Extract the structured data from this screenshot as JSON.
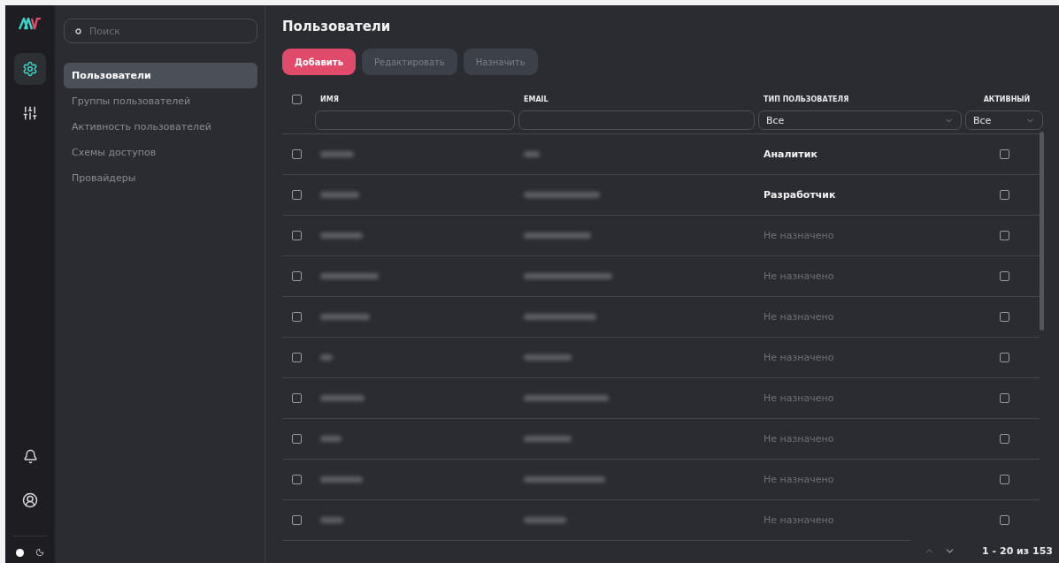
{
  "sidebar": {
    "search": {
      "placeholder": "Поиск"
    },
    "items": [
      {
        "label": "Пользователи",
        "selected": true
      },
      {
        "label": "Группы пользователей",
        "selected": false
      },
      {
        "label": "Активность пользователей",
        "selected": false
      },
      {
        "label": "Схемы доступов",
        "selected": false
      },
      {
        "label": "Провайдеры",
        "selected": false
      }
    ]
  },
  "rail": {
    "items": [
      {
        "kind": "settings",
        "selected": true
      },
      {
        "kind": "sliders",
        "selected": false
      }
    ],
    "theme_dark": true
  },
  "page": {
    "title": "Пользователи"
  },
  "buttons": [
    {
      "label": "Добавить",
      "disabled": false
    },
    {
      "label": "Редактировать",
      "disabled": true
    },
    {
      "label": "Назначить",
      "disabled": true
    }
  ],
  "table": {
    "select_all_checked": false,
    "columns": [
      {
        "label": "ИМЯ",
        "filter": {
          "kind": "text"
        }
      },
      {
        "label": "EMAIL",
        "filter": {
          "kind": "text"
        }
      },
      {
        "label": "ТИП ПОЛЬЗОВАТЕЛЯ",
        "filter": {
          "kind": "select",
          "value": "Все"
        }
      },
      {
        "label": "АКТИВНЫЙ",
        "filter": {
          "kind": "select",
          "value": "Все"
        }
      }
    ],
    "rows": [
      {
        "checked": false,
        "type": "Аналитик",
        "assigned": true,
        "active": false
      },
      {
        "checked": false,
        "type": "Разработчик",
        "assigned": true,
        "active": false
      },
      {
        "checked": false,
        "type": "Не назначено",
        "assigned": false,
        "active": false
      },
      {
        "checked": false,
        "type": "Не назначено",
        "assigned": false,
        "active": false
      },
      {
        "checked": false,
        "type": "Не назначено",
        "assigned": false,
        "active": false
      },
      {
        "checked": false,
        "type": "Не назначено",
        "assigned": false,
        "active": false
      },
      {
        "checked": false,
        "type": "Не назначено",
        "assigned": false,
        "active": false
      },
      {
        "checked": false,
        "type": "Не назначено",
        "assigned": false,
        "active": false
      },
      {
        "checked": false,
        "type": "Не назначено",
        "assigned": false,
        "active": false
      },
      {
        "checked": false,
        "type": "Не назначено",
        "assigned": false,
        "active": false
      }
    ]
  },
  "pagination": {
    "range": "1 - 20 из 153",
    "prev_disabled": true,
    "next_disabled": false
  }
}
